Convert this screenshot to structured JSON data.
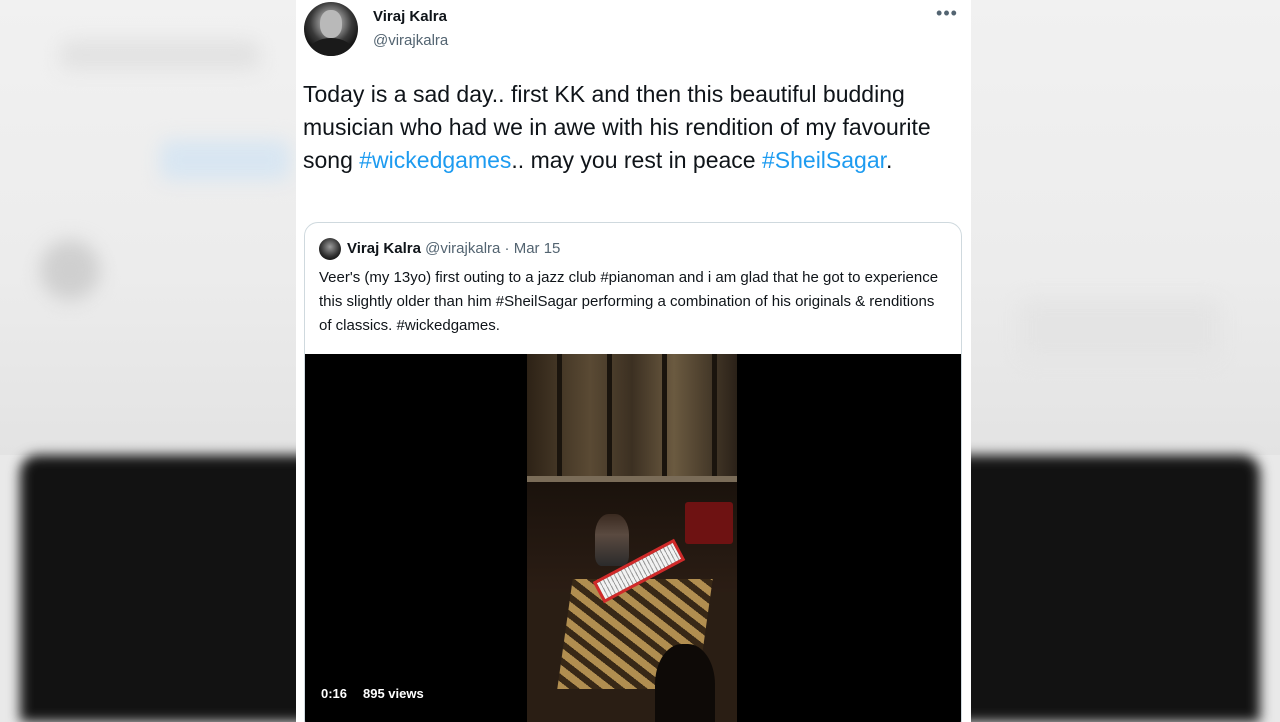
{
  "tweet": {
    "display_name": "Viraj Kalra",
    "handle": "@virajkalra",
    "more_icon": "ellipsis-icon",
    "text_parts": {
      "t1": "Today is a sad day.. first KK and then this beautiful budding musician who had we in awe with his rendition of my favourite song ",
      "h1": "#wickedgames",
      "t2": ".. may you rest in peace ",
      "h2": "#SheilSagar",
      "t3": "."
    },
    "hashtag_color": "#1d9bf0"
  },
  "quote": {
    "display_name": "Viraj Kalra",
    "handle": "@virajkalra",
    "separator": "·",
    "date": "Mar 15",
    "text": "Veer's (my 13yo) first outing to a jazz club #pianoman and i am glad that he got to experience this slightly older than him #SheilSagar performing a combination of his originals & renditions of classics. #wickedgames.",
    "video": {
      "duration": "0:16",
      "views": "895 views"
    }
  }
}
